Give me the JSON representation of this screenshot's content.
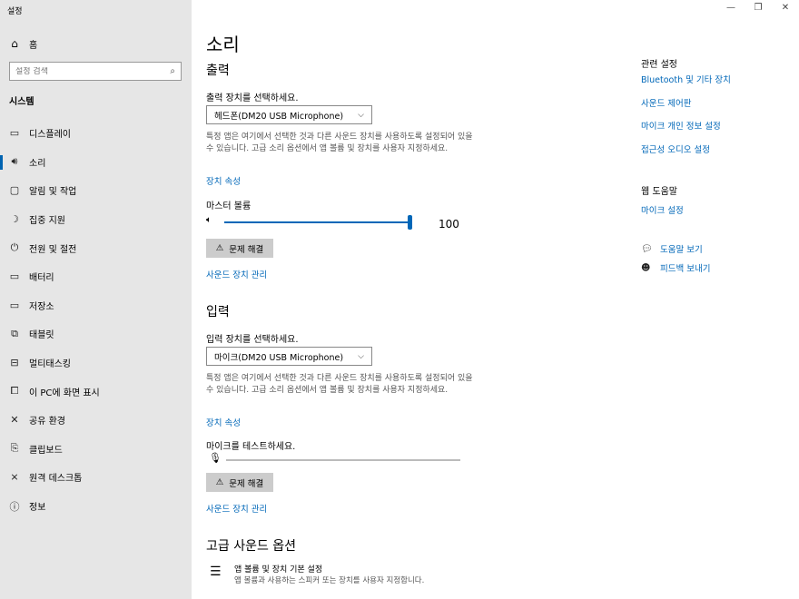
{
  "window": {
    "title": "설정",
    "controls": [
      "—",
      "❐",
      "✕"
    ]
  },
  "sidebar": {
    "home": {
      "icon": "home-icon",
      "label": "홈"
    },
    "search": {
      "placeholder": "설정 검색"
    },
    "section": "시스템",
    "items": [
      {
        "icon": "display-icon",
        "label": "디스플레이"
      },
      {
        "icon": "sound-icon",
        "label": "소리",
        "active": true
      },
      {
        "icon": "notification-icon",
        "label": "알림 및 작업"
      },
      {
        "icon": "moon-icon",
        "label": "집중 지원"
      },
      {
        "icon": "power-icon",
        "label": "전원 및 절전"
      },
      {
        "icon": "battery-icon",
        "label": "배터리"
      },
      {
        "icon": "storage-icon",
        "label": "저장소"
      },
      {
        "icon": "tablet-icon",
        "label": "태블릿"
      },
      {
        "icon": "multitask-icon",
        "label": "멀티태스킹"
      },
      {
        "icon": "project-icon",
        "label": "이 PC에 화면 표시"
      },
      {
        "icon": "share-icon",
        "label": "공유 환경"
      },
      {
        "icon": "clipboard-icon",
        "label": "클립보드"
      },
      {
        "icon": "remote-desktop-icon",
        "label": "원격 데스크톱"
      },
      {
        "icon": "info-icon",
        "label": "정보"
      }
    ]
  },
  "main": {
    "title": "소리",
    "output": {
      "heading": "출력",
      "device_label": "출력 장치를 선택하세요.",
      "device_value": "헤드폰(DM20 USB Microphone)",
      "description": "특정 앱은 여기에서 선택한 것과 다른 사운드 장치를 사용하도록 설정되어 있을 수 있습니다. 고급 소리 옵션에서 앱 볼륨 및 장치를 사용자 지정하세요.",
      "device_properties": "장치 속성",
      "volume_label": "마스터 볼륨",
      "volume": 100,
      "volume_text": "100",
      "troubleshoot": "문제 해결",
      "manage": "사운드 장치 관리"
    },
    "input": {
      "heading": "입력",
      "device_label": "입력 장치를 선택하세요.",
      "device_value": "마이크(DM20 USB Microphone)",
      "description": "특정 앱은 여기에서 선택한 것과 다른 사운드 장치를 사용하도록 설정되어 있을 수 있습니다. 고급 소리 옵션에서 앱 볼륨 및 장치를 사용자 지정하세요.",
      "device_properties": "장치 속성",
      "test_label": "마이크를 테스트하세요.",
      "troubleshoot": "문제 해결",
      "manage": "사운드 장치 관리"
    },
    "advanced": {
      "heading": "고급 사운드 옵션",
      "item_title": "앱 볼륨 및 장치 기본 설정",
      "item_desc": "앱 볼륨과 사용하는 스피커 또는 장치를 사용자 지정합니다."
    }
  },
  "right": {
    "related_heading": "관련 설정",
    "related_links": [
      "Bluetooth 및 기타 장치",
      "사운드 제어판",
      "마이크 개인 정보 설정",
      "접근성 오디오 설정"
    ],
    "web_help_heading": "웹 도움말",
    "web_help_link": "마이크 설정",
    "help": {
      "icon": "help-icon",
      "label": "도움말 보기"
    },
    "feedback": {
      "icon": "feedback-icon",
      "label": "피드백 보내기"
    }
  },
  "colors": {
    "accent": "#0067b8",
    "sidebar_bg": "#e6e6e6",
    "button_bg": "#cccccc"
  }
}
